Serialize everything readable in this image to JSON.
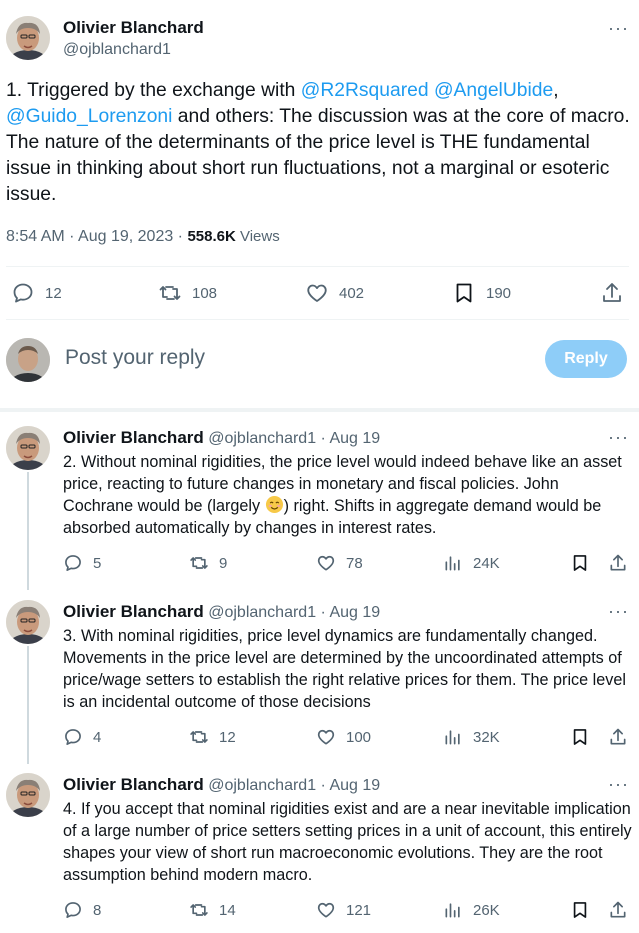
{
  "main": {
    "author_name": "Olivier Blanchard",
    "author_handle": "@ojblanchard1",
    "text_parts": {
      "prefix": "1. Triggered by the exchange with ",
      "mention1": "@R2Rsquared",
      "space": " ",
      "mention2": "@AngelUbide",
      "comma": ",",
      "mention3": "@Guido_Lorenzoni",
      "rest": " and others:  The discussion was at the core of macro. The nature of the determinants of the price level is THE fundamental issue in thinking about short run fluctuations, not a marginal or esoteric issue."
    },
    "timestamp": "8:54 AM · Aug 19, 2023",
    "sep": " · ",
    "views_count": "558.6K",
    "views_label": " Views",
    "stats": {
      "replies": "12",
      "retweets": "108",
      "likes": "402",
      "bookmarks": "190"
    }
  },
  "composer": {
    "placeholder": "Post your reply",
    "reply_button": "Reply"
  },
  "replies": [
    {
      "name": "Olivier Blanchard",
      "handle": "@ojblanchard1",
      "date": " · Aug 19",
      "text_before": "2. Without nominal rigidities, the price level would indeed behave like an asset price, reacting to future changes in monetary and fiscal policies. John Cochrane would be (largely ",
      "text_after": ") right. Shifts in aggregate demand would be absorbed automatically by changes in interest rates.",
      "replies": "5",
      "retweets": "9",
      "likes": "78",
      "views": "24K"
    },
    {
      "name": "Olivier Blanchard",
      "handle": "@ojblanchard1",
      "date": " · Aug 19",
      "text": "3. With nominal rigidities, price level dynamics are fundamentally changed. Movements in the price level are determined by the uncoordinated attempts of price/wage setters to establish the right relative prices for them. The price level is an incidental outcome of those decisions",
      "replies": "4",
      "retweets": "12",
      "likes": "100",
      "views": "32K"
    },
    {
      "name": "Olivier Blanchard",
      "handle": "@ojblanchard1",
      "date": " · Aug 19",
      "text": "4. If you accept that nominal rigidities exist and are a near inevitable implication of a large number of price setters setting prices in a unit of account, this entirely shapes your view of short run macroeconomic evolutions. They are the root assumption behind modern macro.",
      "replies": "8",
      "retweets": "14",
      "likes": "121",
      "views": "26K"
    }
  ],
  "icons": {
    "more": "more-dots-icon",
    "reply": "reply-bubble-icon",
    "retweet": "retweet-icon",
    "like": "heart-icon",
    "bookmark": "bookmark-icon",
    "share": "share-icon",
    "views": "views-bars-icon",
    "emoji": "smiling-face-emoji"
  },
  "colors": {
    "accent": "#1d9bf0",
    "reply_button_bg": "#8ecdf8",
    "secondary_text": "#536471"
  }
}
